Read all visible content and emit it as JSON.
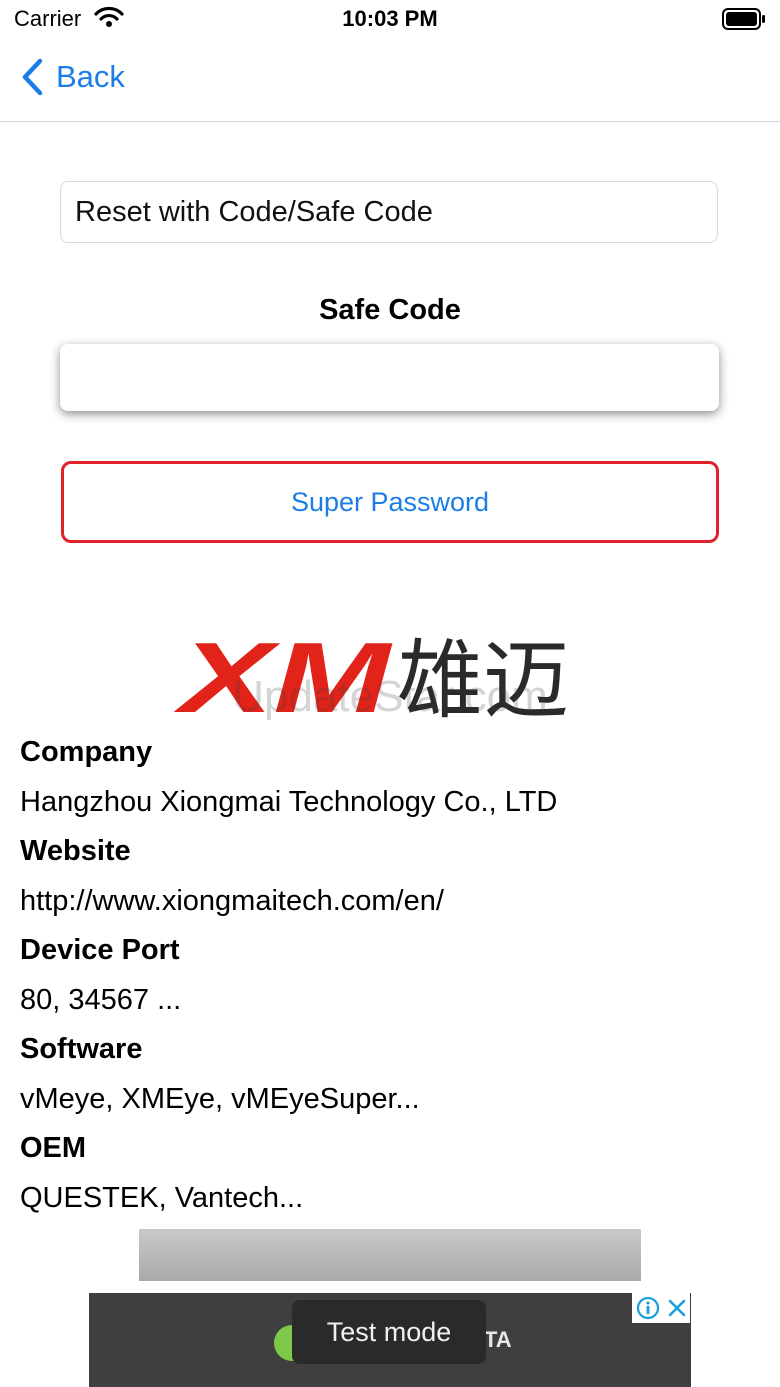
{
  "status_bar": {
    "carrier": "Carrier",
    "time": "10:03 PM"
  },
  "nav": {
    "back_label": "Back"
  },
  "reset_mode": {
    "value": "Reset with Code/Safe Code"
  },
  "safe_code": {
    "label": "Safe Code",
    "value": ""
  },
  "super_password": {
    "label": "Super Password"
  },
  "logo": {
    "brand_text": "XM",
    "chinese_text": "雄迈",
    "watermark": "UpdateStar.com"
  },
  "info": {
    "company_label": "Company",
    "company_value": "Hangzhou Xiongmai Technology Co., LTD",
    "website_label": "Website",
    "website_value": "http://www.xiongmaitech.com/en/",
    "port_label": "Device Port",
    "port_value": "80, 34567 ...",
    "software_label": "Software",
    "software_value": "vMeye, XMEye, vMEyeSuper...",
    "oem_label": "OEM",
    "oem_value": "QUESTEK, Vantech..."
  },
  "ad": {
    "toast": "Test mode",
    "partial_text": "TA"
  },
  "colors": {
    "accent": "#1a7de8",
    "button_border": "#e0202a",
    "logo_red": "#e2231a"
  }
}
